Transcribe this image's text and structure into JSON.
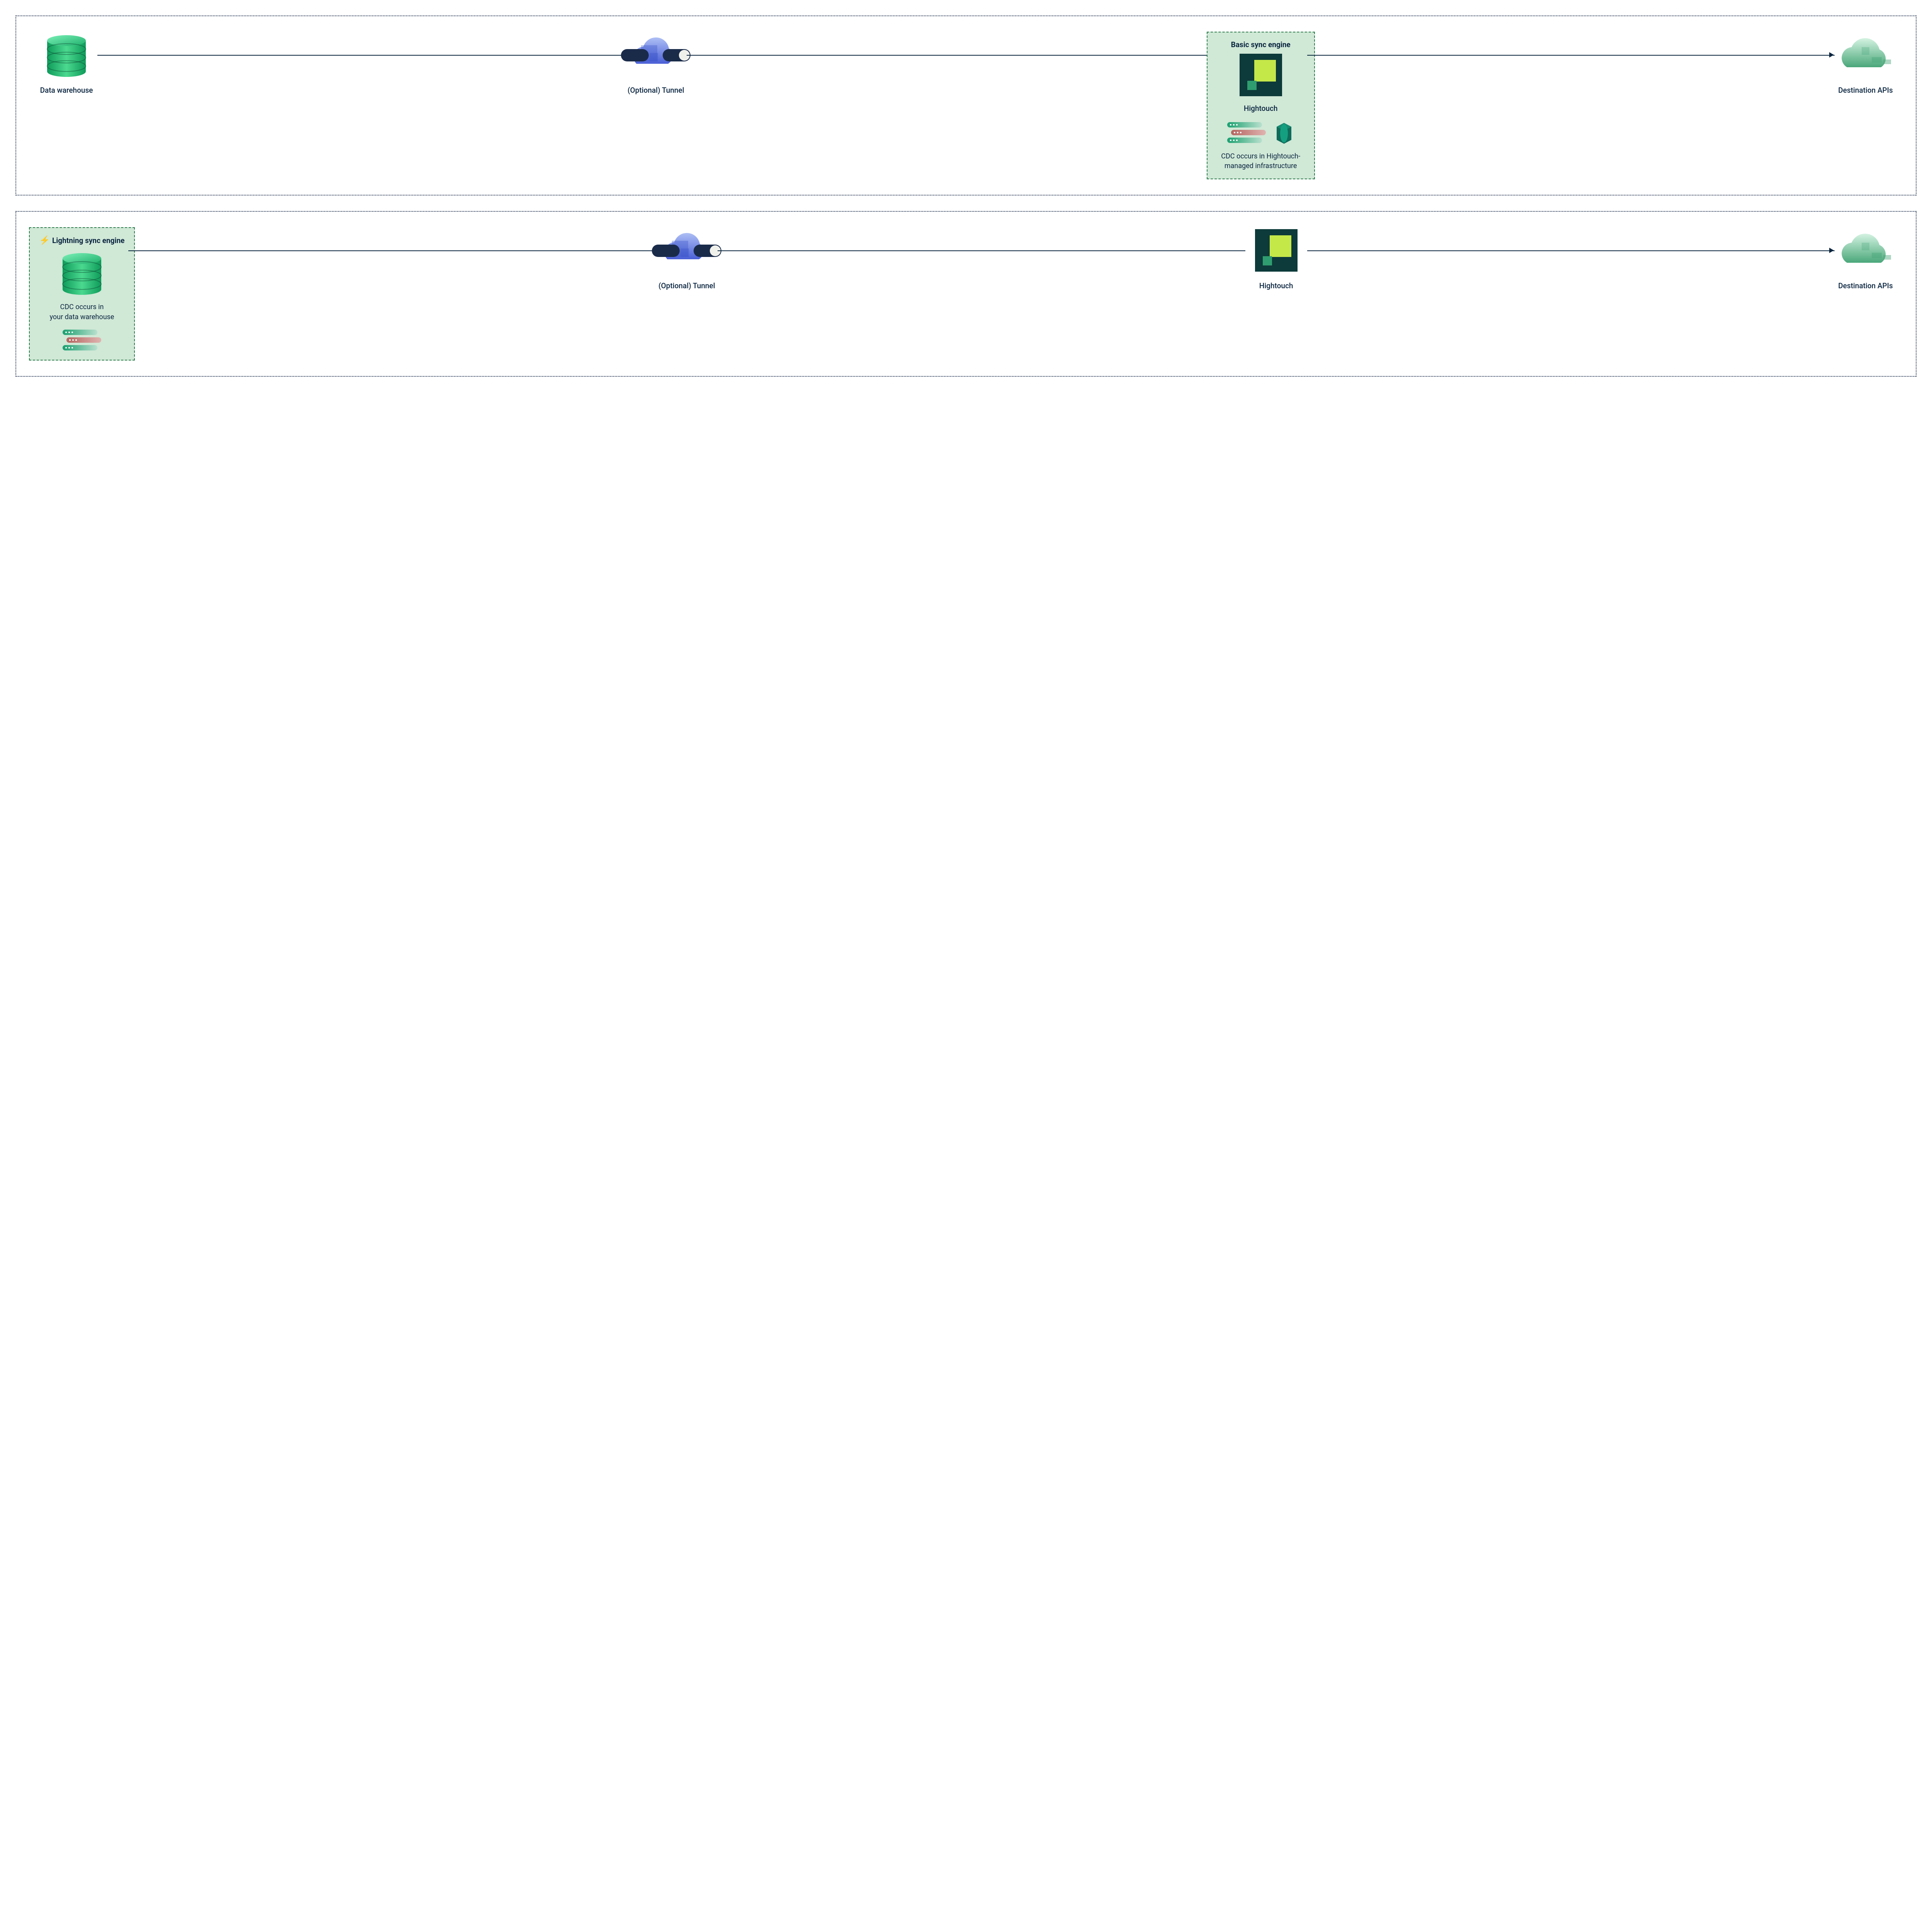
{
  "panel1": {
    "basic_title": "Basic sync engine",
    "nodes": {
      "warehouse": "Data warehouse",
      "tunnel": "(Optional) Tunnel",
      "hightouch": "Hightouch",
      "destination": "Destination APIs"
    },
    "cdc_text": "CDC occurs in Hightouch-managed infrastructure"
  },
  "panel2": {
    "lightning_title": "Lightning sync engine",
    "cdc_text": "CDC occurs in\nyour data warehouse",
    "nodes": {
      "tunnel": "(Optional) Tunnel",
      "hightouch": "Hightouch",
      "destination": "Destination APIs"
    }
  }
}
